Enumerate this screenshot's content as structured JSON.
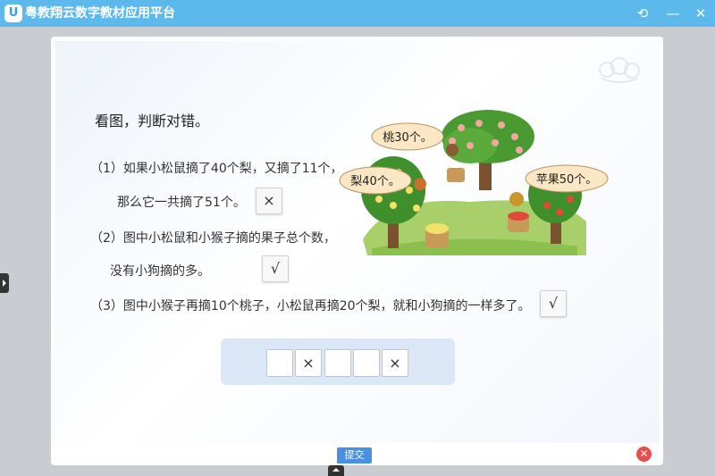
{
  "window": {
    "title": "粤教翔云数字教材应用平台",
    "logo_letter": "U",
    "controls": {
      "refresh": "⟲",
      "minimize": "—",
      "close": "✕"
    }
  },
  "exercise": {
    "heading": "看图，判断对错。",
    "questions": [
      {
        "lines": [
          "（1）如果小松鼠摘了40个梨，又摘了11个，",
          "那么它一共摘了51个。"
        ],
        "answer": "×"
      },
      {
        "lines": [
          "（2）图中小松鼠和小猴子摘的果子总个数，",
          "没有小狗摘的多。"
        ],
        "answer": "√"
      },
      {
        "lines": [
          "（3）图中小猴子再摘10个桃子，小松鼠再摘20个梨，就和小狗摘的一样多了。"
        ],
        "answer": "√"
      }
    ],
    "illustration": {
      "labels": [
        "桃30个。",
        "梨40个。",
        "苹果50个。"
      ]
    },
    "answer_slots": [
      "",
      "×",
      "",
      "",
      "×"
    ]
  },
  "footer": {
    "submit_label": "提交",
    "close_icon": "✕"
  },
  "colors": {
    "titlebar": "#5db8ec",
    "answer_strip": "#d9e7f7",
    "submit": "#4a90e2",
    "close": "#e84c4c"
  }
}
